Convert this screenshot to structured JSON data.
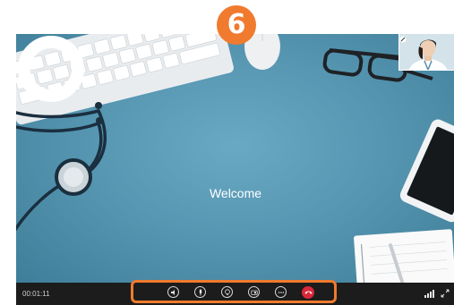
{
  "step_badge": "6",
  "welcome_text": "Welcome",
  "timer": "00:01:11",
  "controls": [
    {
      "name": "volume-button",
      "icon": "speaker-icon"
    },
    {
      "name": "microphone-button",
      "icon": "microphone-icon"
    },
    {
      "name": "effects-button",
      "icon": "bulb-icon"
    },
    {
      "name": "camera-button",
      "icon": "video-camera-icon"
    },
    {
      "name": "more-button",
      "icon": "ellipsis-icon"
    },
    {
      "name": "end-call-button",
      "icon": "phone-hangup-icon"
    }
  ],
  "colors": {
    "accent_orange": "#f07a2e",
    "hangup_red": "#d9283a",
    "background_blue": "#4f8eaa",
    "toolbar": "#1c1c1c"
  }
}
